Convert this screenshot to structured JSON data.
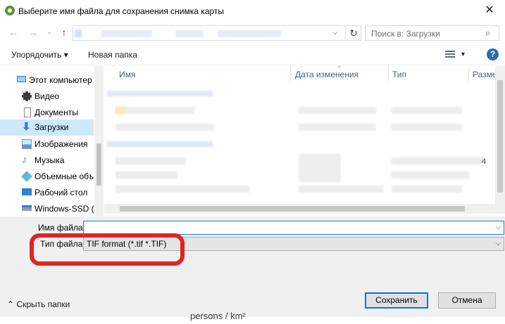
{
  "window": {
    "title": "Выберите имя файла для сохранения снимка карты",
    "close_symbol": "✕"
  },
  "nav": {
    "back": "←",
    "forward": "→",
    "history": "⌄",
    "up": "↑",
    "address_dropdown": "⌵",
    "refresh": "↻"
  },
  "search": {
    "placeholder": "Поиск в: Загрузки",
    "icon": "⌕"
  },
  "toolbar": {
    "organize_label": "Упорядочить ▾",
    "new_folder_label": "Новая папка",
    "view_dropdown": "▾",
    "help_label": "?"
  },
  "sidebar": {
    "items": [
      {
        "label": "Этот компьютер",
        "icon": "computer-icon"
      },
      {
        "label": "Видео",
        "icon": "video-icon"
      },
      {
        "label": "Документы",
        "icon": "documents-icon"
      },
      {
        "label": "Загрузки",
        "icon": "downloads-icon",
        "selected": true
      },
      {
        "label": "Изображения",
        "icon": "pictures-icon"
      },
      {
        "label": "Музыка",
        "icon": "music-icon"
      },
      {
        "label": "Объемные объ",
        "icon": "3d-objects-icon"
      },
      {
        "label": "Рабочий стол",
        "icon": "desktop-icon"
      },
      {
        "label": "Windows-SSD (C",
        "icon": "drive-icon"
      }
    ]
  },
  "file_list": {
    "columns": [
      "Имя",
      "Дата изменения",
      "Тип",
      "Разме"
    ],
    "size_fragment": "4"
  },
  "form": {
    "filename_label": "Имя файла:",
    "filename_value": "",
    "filetype_label": "Тип файла:",
    "filetype_value": "TIF format (*.tif *.TIF)"
  },
  "footer": {
    "hide_folders_label": "Скрыть папки",
    "save_label": "Сохранить",
    "cancel_label": "Отмена"
  },
  "background_text": "persons / km²",
  "colors": {
    "selection": "#cde8ff",
    "accent": "#0078d7",
    "highlight_ring": "#e02424"
  }
}
